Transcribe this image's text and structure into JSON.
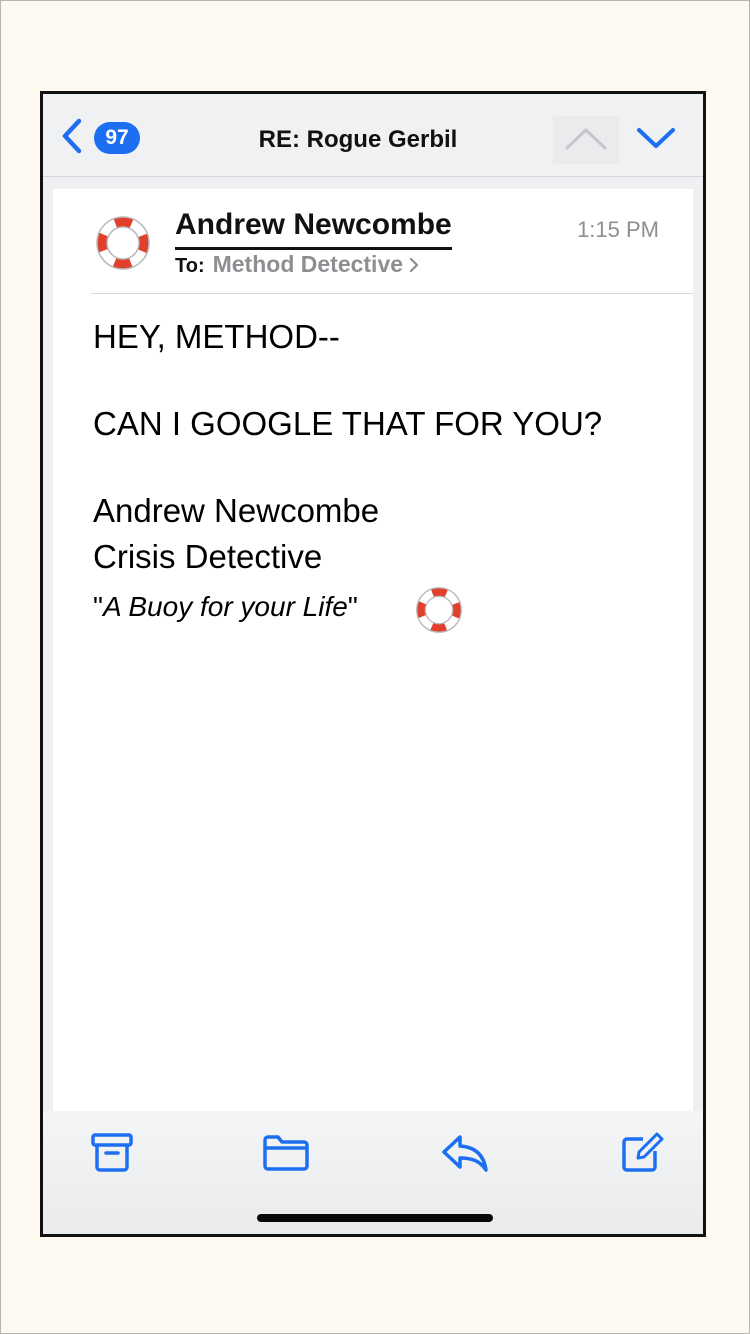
{
  "navbar": {
    "unread_count": "97",
    "title": "RE: Rogue Gerbil"
  },
  "message": {
    "sender": "Andrew Newcombe",
    "time": "1:15 PM",
    "to_label": "To:",
    "recipient": "Method Detective",
    "greeting": "HEY, METHOD--",
    "question": "CAN I GOOGLE THAT FOR YOU?",
    "signature": {
      "name": "Andrew Newcombe",
      "title": "Crisis Detective",
      "quote_open": "\"",
      "quote_text": "A Buoy for your Life",
      "quote_close": "\""
    }
  },
  "icons": {
    "back": "chevron-left-icon",
    "previous": "chevron-up-icon",
    "next": "chevron-down-icon",
    "avatar": "lifebuoy-icon",
    "toolbar": [
      "archive-icon",
      "folder-icon",
      "reply-icon",
      "compose-icon"
    ]
  },
  "colors": {
    "accent": "#1d6ff2",
    "badge": "#1d6ff2",
    "lifebuoy_red": "#e0402c",
    "page_background": "#fdf8f0"
  }
}
